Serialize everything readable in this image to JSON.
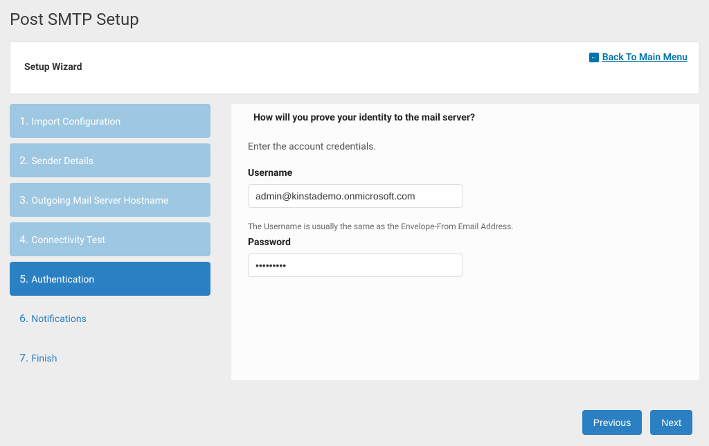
{
  "pageTitle": "Post SMTP Setup",
  "header": {
    "wizardTitle": "Setup Wizard",
    "backLink": "Back To Main Menu"
  },
  "steps": [
    {
      "num": "1.",
      "label": "Import Configuration",
      "state": "completed"
    },
    {
      "num": "2.",
      "label": "Sender Details",
      "state": "completed"
    },
    {
      "num": "3.",
      "label": "Outgoing Mail Server Hostname",
      "state": "completed"
    },
    {
      "num": "4.",
      "label": "Connectivity Test",
      "state": "completed"
    },
    {
      "num": "5.",
      "label": "Authentication",
      "state": "active"
    },
    {
      "num": "6.",
      "label": "Notifications",
      "state": "upcoming"
    },
    {
      "num": "7.",
      "label": "Finish",
      "state": "upcoming"
    }
  ],
  "content": {
    "heading": "How will you prove your identity to the mail server?",
    "instructions": "Enter the account credentials.",
    "usernameLabel": "Username",
    "usernameValue": "admin@kinstademo.onmicrosoft.com",
    "usernameHelper": "The Username is usually the same as the Envelope-From Email Address.",
    "passwordLabel": "Password",
    "passwordValue": "password1"
  },
  "buttons": {
    "previous": "Previous",
    "next": "Next"
  }
}
